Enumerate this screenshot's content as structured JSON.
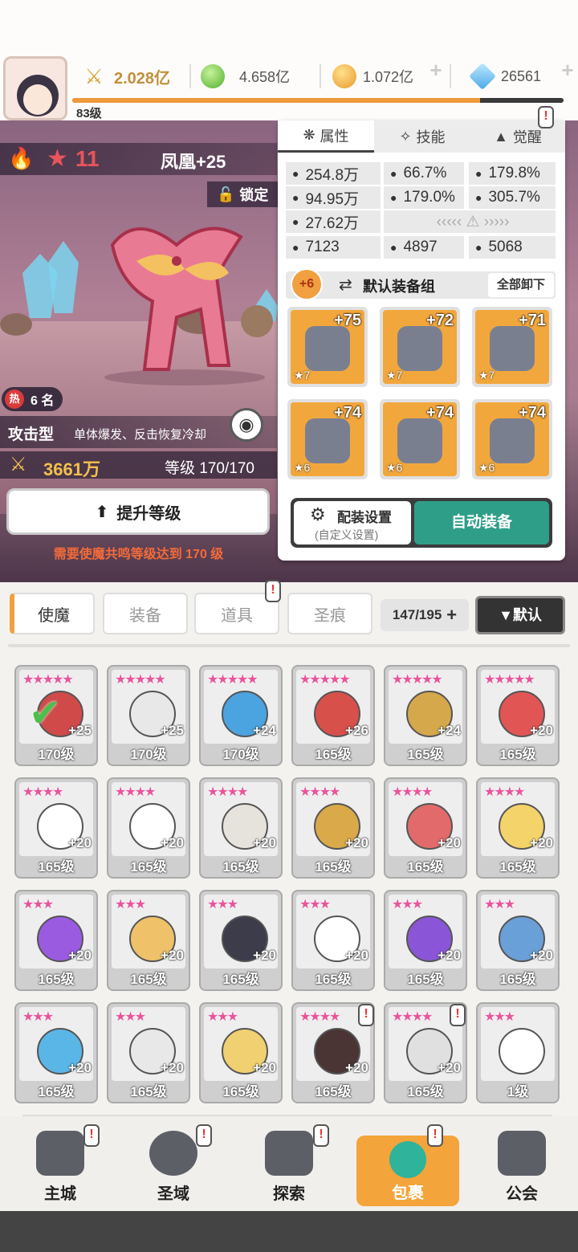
{
  "topbar": {
    "player_level": "83级",
    "power": "2.028亿",
    "gem_green": "4.658亿",
    "coin": "1.072亿",
    "diamond": "26561",
    "exp_progress": 0.83
  },
  "hero": {
    "stars": "11",
    "name": "凤凰+25",
    "lock_label": "锁定",
    "rank_label": "热",
    "rank_value": "6 名",
    "type": "攻击型",
    "desc": "单体爆发、反击恢复冷却",
    "power": "3661万",
    "level_text": "等级 170/170",
    "upgrade_label": "提升等级",
    "requirement": "需要使魔共鸣等级达到 170 级"
  },
  "panel": {
    "tabs": [
      "属性",
      "技能",
      "觉醒"
    ],
    "stats": [
      {
        "icon": "heart-icon",
        "value": "254.8万"
      },
      {
        "icon": "burst-icon",
        "value": "66.7%"
      },
      {
        "icon": "gear-burst-icon",
        "value": "179.8%"
      },
      {
        "icon": "sword-icon",
        "value": "94.95万"
      },
      {
        "icon": "crosshair-icon",
        "value": "179.0%"
      },
      {
        "icon": "speed-icon",
        "value": "305.7%"
      },
      {
        "icon": "shield-icon",
        "value": "27.62万"
      },
      {
        "icon": "swirl-icon",
        "value": "7123"
      },
      {
        "icon": "wind-icon",
        "value": "4897"
      },
      {
        "icon": "spiral-icon",
        "value": "5068"
      }
    ],
    "set_badge": "+6",
    "set_name": "默认装备组",
    "unequip_all": "全部卸下",
    "gear": [
      {
        "plus": "+75",
        "stars": "★7",
        "color": "#f2a73c"
      },
      {
        "plus": "+72",
        "stars": "★7",
        "color": "#f2a73c"
      },
      {
        "plus": "+71",
        "stars": "★7",
        "color": "#f2a73c"
      },
      {
        "plus": "+74",
        "stars": "★6",
        "color": "#f2a73c"
      },
      {
        "plus": "+74",
        "stars": "★6",
        "color": "#f2a73c"
      },
      {
        "plus": "+74",
        "stars": "★6",
        "color": "#f2a73c"
      }
    ],
    "config_label": "配装设置",
    "config_sub": "(自定义设置)",
    "auto_equip": "自动装备"
  },
  "filters": {
    "tabs": [
      "使魔",
      "装备",
      "道具",
      "圣痕"
    ],
    "count": "147/195",
    "sort": "▼默认"
  },
  "cards": [
    {
      "lv": "170级",
      "plus": "+25",
      "stars": "★★★★★",
      "color": "#d04a4a"
    },
    {
      "lv": "170级",
      "plus": "+25",
      "stars": "★★★★★",
      "color": "#e8e8e8"
    },
    {
      "lv": "170级",
      "plus": "+24",
      "stars": "★★★★★",
      "color": "#4ba3e0"
    },
    {
      "lv": "165级",
      "plus": "+26",
      "stars": "★★★★★",
      "color": "#d8504a"
    },
    {
      "lv": "165级",
      "plus": "+24",
      "stars": "★★★★★",
      "color": "#d6a84c"
    },
    {
      "lv": "165级",
      "plus": "+20",
      "stars": "★★★★★",
      "color": "#e25555"
    },
    {
      "lv": "165级",
      "plus": "+20",
      "stars": "★★★★",
      "color": "#ffffff"
    },
    {
      "lv": "165级",
      "plus": "+20",
      "stars": "★★★★",
      "color": "#ffffff"
    },
    {
      "lv": "165级",
      "plus": "+20",
      "stars": "★★★★",
      "color": "#e6e3dc"
    },
    {
      "lv": "165级",
      "plus": "+20",
      "stars": "★★★★",
      "color": "#d9a94a"
    },
    {
      "lv": "165级",
      "plus": "+20",
      "stars": "★★★★",
      "color": "#e36a6a"
    },
    {
      "lv": "165级",
      "plus": "+20",
      "stars": "★★★★",
      "color": "#f3d36a"
    },
    {
      "lv": "165级",
      "plus": "+20",
      "stars": "★★★",
      "color": "#9a5be0"
    },
    {
      "lv": "165级",
      "plus": "+20",
      "stars": "★★★",
      "color": "#efc26a"
    },
    {
      "lv": "165级",
      "plus": "+20",
      "stars": "★★★",
      "color": "#3c3c4a"
    },
    {
      "lv": "165级",
      "plus": "+20",
      "stars": "★★★",
      "color": "#ffffff"
    },
    {
      "lv": "165级",
      "plus": "+20",
      "stars": "★★★",
      "color": "#8a55d6"
    },
    {
      "lv": "165级",
      "plus": "+20",
      "stars": "★★★",
      "color": "#6aa0d8"
    },
    {
      "lv": "165级",
      "plus": "+20",
      "stars": "★★★",
      "color": "#5bb6e8"
    },
    {
      "lv": "165级",
      "plus": "+20",
      "stars": "★★★",
      "color": "#e8e8e8"
    },
    {
      "lv": "165级",
      "plus": "+20",
      "stars": "★★★",
      "color": "#f0d070"
    },
    {
      "lv": "165级",
      "plus": "+20",
      "stars": "★★★★",
      "color": "#4a3434"
    },
    {
      "lv": "165级",
      "plus": "+20",
      "stars": "★★★★",
      "color": "#e0e0e0"
    },
    {
      "lv": "1级",
      "plus": "",
      "stars": "★★★",
      "color": "#ffffff"
    }
  ],
  "nav": [
    "主城",
    "圣域",
    "探索",
    "包裹",
    "公会"
  ]
}
